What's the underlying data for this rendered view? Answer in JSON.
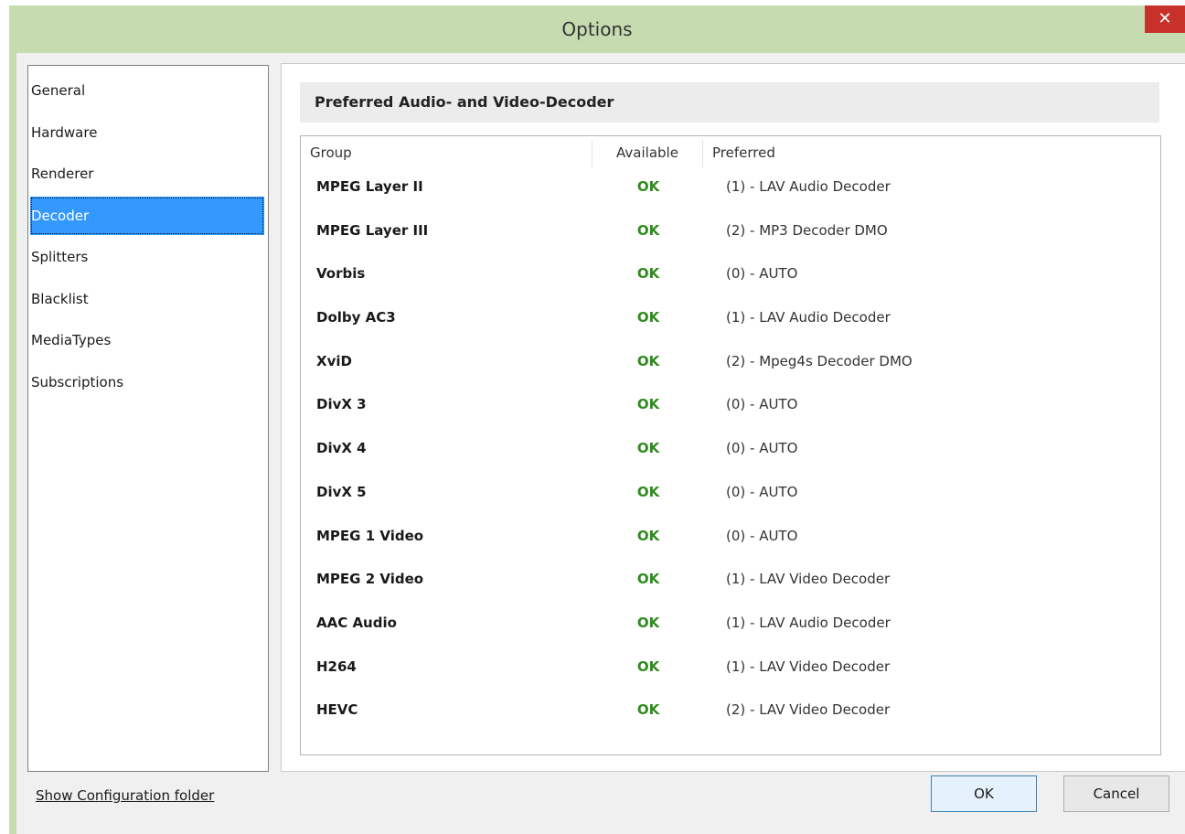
{
  "window": {
    "title": "Options",
    "close_glyph": "✕"
  },
  "nav": {
    "items": [
      {
        "label": "General",
        "selected": false
      },
      {
        "label": "Hardware",
        "selected": false
      },
      {
        "label": "Renderer",
        "selected": false
      },
      {
        "label": "Decoder",
        "selected": true
      },
      {
        "label": "Splitters",
        "selected": false
      },
      {
        "label": "Blacklist",
        "selected": false
      },
      {
        "label": "MediaTypes",
        "selected": false
      },
      {
        "label": "Subscriptions",
        "selected": false
      }
    ]
  },
  "section": {
    "title": "Preferred Audio- and Video-Decoder"
  },
  "table": {
    "columns": {
      "group": "Group",
      "available": "Available",
      "preferred": "Preferred"
    },
    "rows": [
      {
        "group": "MPEG Layer II",
        "available": "OK",
        "preferred": "(1) - LAV Audio Decoder"
      },
      {
        "group": "MPEG Layer III",
        "available": "OK",
        "preferred": "(2) - MP3 Decoder DMO"
      },
      {
        "group": "Vorbis",
        "available": "OK",
        "preferred": "(0) - AUTO"
      },
      {
        "group": "Dolby AC3",
        "available": "OK",
        "preferred": "(1) - LAV Audio Decoder"
      },
      {
        "group": "XviD",
        "available": "OK",
        "preferred": "(2) - Mpeg4s Decoder DMO"
      },
      {
        "group": "DivX 3",
        "available": "OK",
        "preferred": "(0) - AUTO"
      },
      {
        "group": "DivX 4",
        "available": "OK",
        "preferred": "(0) - AUTO"
      },
      {
        "group": "DivX 5",
        "available": "OK",
        "preferred": "(0) - AUTO"
      },
      {
        "group": "MPEG 1 Video",
        "available": "OK",
        "preferred": "(0) - AUTO"
      },
      {
        "group": "MPEG 2 Video",
        "available": "OK",
        "preferred": "(1) - LAV Video Decoder"
      },
      {
        "group": "AAC Audio",
        "available": "OK",
        "preferred": "(1) - LAV Audio Decoder"
      },
      {
        "group": "H264",
        "available": "OK",
        "preferred": "(1) - LAV Video Decoder"
      },
      {
        "group": "HEVC",
        "available": "OK",
        "preferred": "(2) - LAV Video Decoder"
      }
    ]
  },
  "footer": {
    "config_link": "Show Configuration folder",
    "ok_label": "OK",
    "cancel_label": "Cancel"
  },
  "colors": {
    "titlebar": "#c6dcb0",
    "selection": "#3399ff",
    "ok_status": "#2e8b1d",
    "close_button": "#c7312a"
  }
}
